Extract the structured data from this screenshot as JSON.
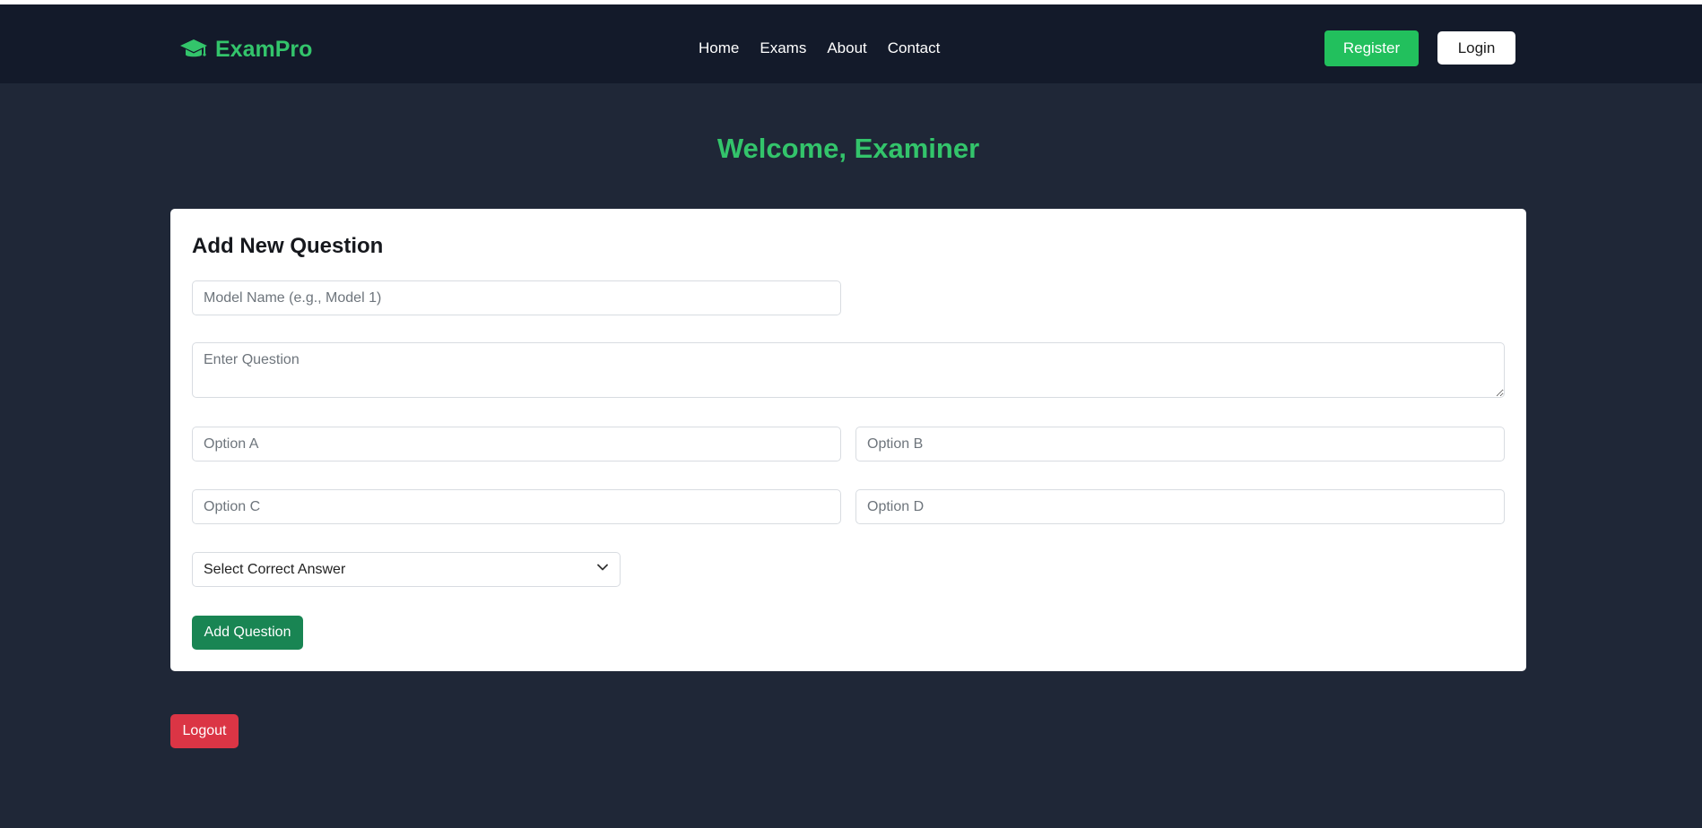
{
  "brand": {
    "name": "ExamPro",
    "icon": "graduation-cap-icon",
    "color": "#33c46b"
  },
  "nav": {
    "links": [
      "Home",
      "Exams",
      "About",
      "Contact"
    ],
    "register_label": "Register",
    "login_label": "Login"
  },
  "welcome": "Welcome, Examiner",
  "form": {
    "title": "Add New Question",
    "model_placeholder": "Model Name (e.g., Model 1)",
    "question_placeholder": "Enter Question",
    "option_a_placeholder": "Option A",
    "option_b_placeholder": "Option B",
    "option_c_placeholder": "Option C",
    "option_d_placeholder": "Option D",
    "correct_answer_selected": "Select Correct Answer",
    "submit_label": "Add Question"
  },
  "logout_label": "Logout",
  "colors": {
    "navbar": "#131a2a",
    "page_background": "#1f2737",
    "accent_green": "#22c05d",
    "add_button": "#198553",
    "logout": "#db3545"
  }
}
